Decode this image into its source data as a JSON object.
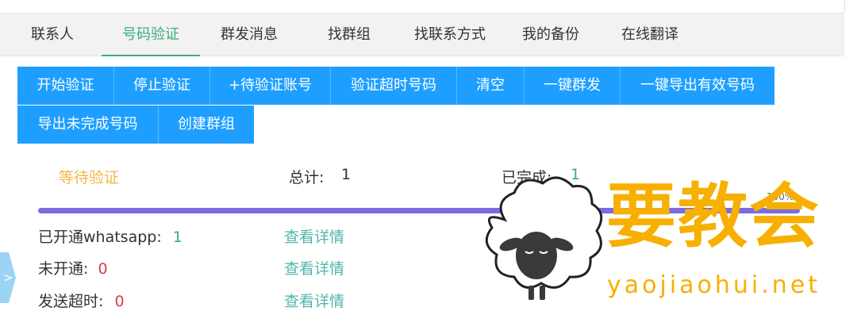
{
  "tabs": [
    {
      "label": "联系人",
      "active": false
    },
    {
      "label": "号码验证",
      "active": true
    },
    {
      "label": "群发消息",
      "active": false
    },
    {
      "label": "找群组",
      "active": false
    },
    {
      "label": "找联系方式",
      "active": false
    },
    {
      "label": "我的备份",
      "active": false
    },
    {
      "label": "在线翻译",
      "active": false
    }
  ],
  "toolbar": {
    "buttons": [
      {
        "label": "开始验证"
      },
      {
        "label": "停止验证"
      },
      {
        "label": "+待验证账号"
      },
      {
        "label": "验证超时号码"
      },
      {
        "label": "清空"
      },
      {
        "label": "一键群发"
      },
      {
        "label": "一键导出有效号码"
      },
      {
        "label": "导出未完成号码"
      },
      {
        "label": "创建群组"
      }
    ]
  },
  "status": {
    "state": "等待验证",
    "total_label": "总计:",
    "total_value": "1",
    "done_label": "已完成:",
    "done_value": "1",
    "progress_text": "100%",
    "progress_fraction": 1.0
  },
  "results": [
    {
      "label": "已开通whatsapp:",
      "value": "1",
      "value_color": "#3aae7a",
      "link": "查看详情"
    },
    {
      "label": "未开通:",
      "value": "0",
      "value_color": "#e0384b",
      "link": "查看详情"
    },
    {
      "label": "发送超时:",
      "value": "0",
      "value_color": "#e0384b",
      "link": "查看详情"
    }
  ],
  "side_handle": ">",
  "watermark": {
    "cn": "要教会",
    "en": "yaojiaohui.net"
  },
  "colors": {
    "accent_green": "#3aae7a",
    "button_blue": "#1e9fff",
    "progress": "#7b6ae0",
    "warning": "#f2b84b",
    "watermark": "#f7b000"
  }
}
